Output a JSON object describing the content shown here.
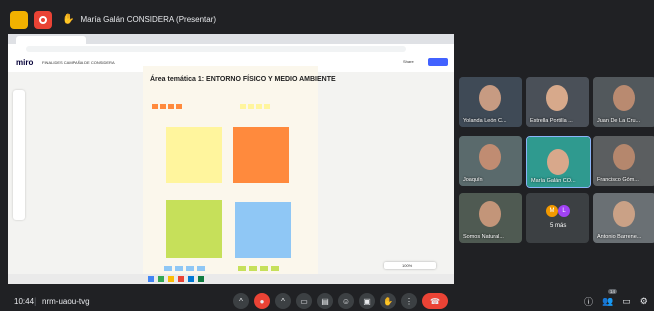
{
  "topbar": {
    "presenter_label": "María Galán CONSIDERA (Presentar)"
  },
  "colors": {
    "accent_yellow": "#f2b100",
    "record_red": "#ea4335",
    "hangup_red": "#ea4335",
    "sticky_yellow": "#fff59d",
    "sticky_orange": "#ff8a3d",
    "sticky_green": "#c6e05a",
    "sticky_blue": "#8fc7f5"
  },
  "miro": {
    "logo": "miro",
    "board_name": "FINALIDES CAMPAÑA DE CONSIDERA",
    "frame_title": "Área temática 1: ENTORNO FÍSICO Y MEDIO AMBIENTE",
    "share_label": "Share",
    "zoom_label": "100%"
  },
  "participants": [
    {
      "name": "Yolanda León C...",
      "bg": "#3f4a56"
    },
    {
      "name": "Estrella Portilla ...",
      "bg": "#4a5058"
    },
    {
      "name": "Juan De La Cru...",
      "bg": "#52585c"
    },
    {
      "name": "Joaquín",
      "bg": "#5a6a6c"
    },
    {
      "name": "María Galán CO...",
      "bg": "#2f9a8f"
    },
    {
      "name": "Francisco Góm...",
      "bg": "#5b5e60"
    },
    {
      "name": "Somos Natural...",
      "bg": "#4f5a52"
    },
    {
      "name": "5 más",
      "bg": "#3c4043"
    },
    {
      "name": "Antonio Barrene...",
      "bg": "#6a7074"
    }
  ],
  "overflow_avatars": [
    "M",
    "L"
  ],
  "bottom": {
    "time": "10:44",
    "meeting_code": "nrm-uaou-tvg",
    "participants_count": "14"
  }
}
